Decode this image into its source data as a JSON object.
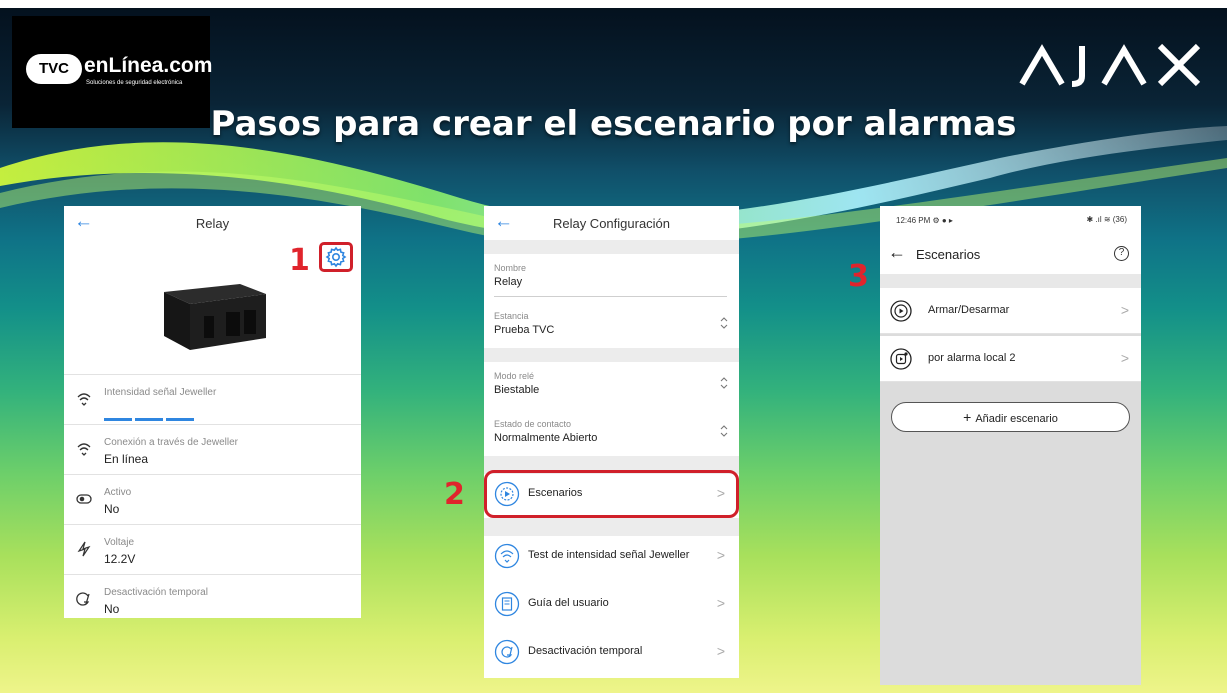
{
  "brand": {
    "tvc_badge": "TVC",
    "tvc_name": "enLínea.com",
    "tvc_tagline": "Soluciones de seguridad electrónica",
    "ajax_logo": "AJAX"
  },
  "title": "Pasos para crear el escenario por alarmas",
  "steps": [
    "1",
    "2",
    "3"
  ],
  "panel1": {
    "back_icon": "arrow-left-icon",
    "title": "Relay",
    "rows": [
      {
        "icon": "signal-icon",
        "label": "Intensidad señal Jeweller",
        "value": ""
      },
      {
        "icon": "signal-icon",
        "label": "Conexión a través de Jeweller",
        "value": "En línea"
      },
      {
        "icon": "toggle-icon",
        "label": "Activo",
        "value": "No"
      },
      {
        "icon": "bolt-icon",
        "label": "Voltaje",
        "value": "12.2V"
      },
      {
        "icon": "deactivate-icon",
        "label": "Desactivación temporal",
        "value": "No"
      }
    ],
    "signal_level": 1.0
  },
  "panel2": {
    "title": "Relay Configuración",
    "fields": [
      {
        "label": "Nombre",
        "value": "Relay"
      },
      {
        "label": "Estancia",
        "value": "Prueba TVC"
      },
      {
        "label": "Modo relé",
        "value": "Biestable"
      },
      {
        "label": "Estado de contacto",
        "value": "Normalmente Abierto"
      }
    ],
    "nav": [
      {
        "icon": "scenario-gear-icon",
        "label": "Escenarios"
      },
      {
        "icon": "signal-icon",
        "label": "Test de intensidad señal Jeweller"
      },
      {
        "icon": "book-icon",
        "label": "Guía del usuario"
      },
      {
        "icon": "deactivate-icon",
        "label": "Desactivación temporal"
      }
    ],
    "chevron": ">"
  },
  "panel3": {
    "status_time": "12:46 PM",
    "status_right": "36",
    "title": "Escenarios",
    "help": "?",
    "items": [
      {
        "icon": "play-circle-icon",
        "label": "Armar/Desarmar"
      },
      {
        "icon": "alarm-play-icon",
        "label": "por alarma local 2"
      }
    ],
    "add_button": "Añadir escenario",
    "chevron": ">"
  },
  "colors": {
    "accent_blue": "#2f86e0",
    "highlight_red": "#d0202a"
  }
}
